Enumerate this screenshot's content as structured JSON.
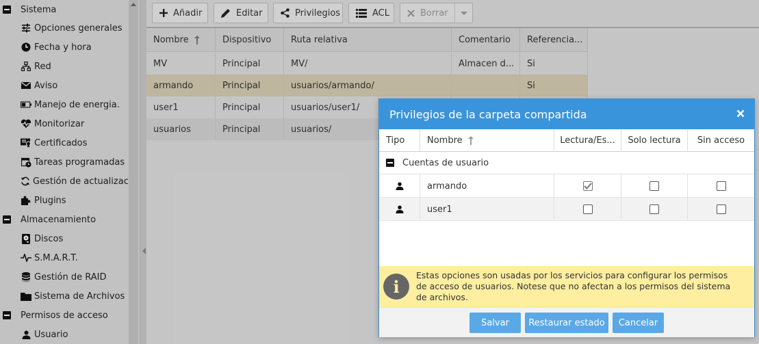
{
  "sidebar": {
    "groups": [
      {
        "label": "Sistema",
        "icon": "minus-box-icon"
      },
      {
        "label": "Almacenamiento",
        "icon": "minus-box-icon"
      },
      {
        "label": "Permisos de acceso",
        "icon": "minus-box-icon"
      }
    ],
    "items": [
      {
        "label": "Opciones generales",
        "icon": "sliders-icon"
      },
      {
        "label": "Fecha y hora",
        "icon": "clock-icon"
      },
      {
        "label": "Red",
        "icon": "network-icon"
      },
      {
        "label": "Aviso",
        "icon": "envelope-icon"
      },
      {
        "label": "Manejo de energia.",
        "icon": "battery-icon"
      },
      {
        "label": "Monitorizar",
        "icon": "heartbeat-icon"
      },
      {
        "label": "Certificados",
        "icon": "certificate-icon"
      },
      {
        "label": "Tareas programadas",
        "icon": "calendar-clock-icon"
      },
      {
        "label": "Gestión de actualizacio",
        "icon": "refresh-icon"
      },
      {
        "label": "Plugins",
        "icon": "puzzle-icon"
      },
      {
        "label": "Discos",
        "icon": "disk-icon"
      },
      {
        "label": "S.M.A.R.T.",
        "icon": "pulse-icon"
      },
      {
        "label": "Gestión de RAID",
        "icon": "database-icon"
      },
      {
        "label": "Sistema de Archivos",
        "icon": "folder-icon"
      },
      {
        "label": "Usuario",
        "icon": "user-icon"
      }
    ]
  },
  "toolbar": {
    "add": "Añadir",
    "edit": "Editar",
    "privileges": "Privilegios",
    "acl": "ACL",
    "delete": "Borrar"
  },
  "grid": {
    "columns": [
      "Nombre",
      "Dispositivo",
      "Ruta relativa",
      "Comentario",
      "Referencia..."
    ],
    "rows": [
      [
        "MV",
        "Principal",
        "MV/",
        "Almacen d...",
        "Si"
      ],
      [
        "armando",
        "Principal",
        "usuarios/armando/",
        "",
        "Si"
      ],
      [
        "user1",
        "Principal",
        "usuarios/user1/",
        "",
        ""
      ],
      [
        "usuarios",
        "Principal",
        "usuarios/",
        "",
        ""
      ]
    ]
  },
  "dialog": {
    "title": "Privilegios de la carpeta compartida",
    "columns": [
      "Tipo",
      "Nombre",
      "Lectura/Es...",
      "Solo lectura",
      "Sin acceso"
    ],
    "group_label": "Cuentas de usuario",
    "rows": [
      {
        "name": "armando",
        "read_write": true,
        "read_only": false,
        "no_access": false
      },
      {
        "name": "user1",
        "read_write": false,
        "read_only": false,
        "no_access": false
      }
    ],
    "info": "Estas opciones son usadas por los servicios para configurar los permisos de acceso de usuarios. Notese que no afectan a los permisos del sistema de archivos.",
    "buttons": {
      "save": "Salvar",
      "reset": "Restaurar estado",
      "cancel": "Cancelar"
    }
  },
  "colors": {
    "dialog_header": "#3a94db",
    "button": "#5aa9e6",
    "info_bg": "#fdeea0",
    "selected_row": "#d4cbb0"
  }
}
